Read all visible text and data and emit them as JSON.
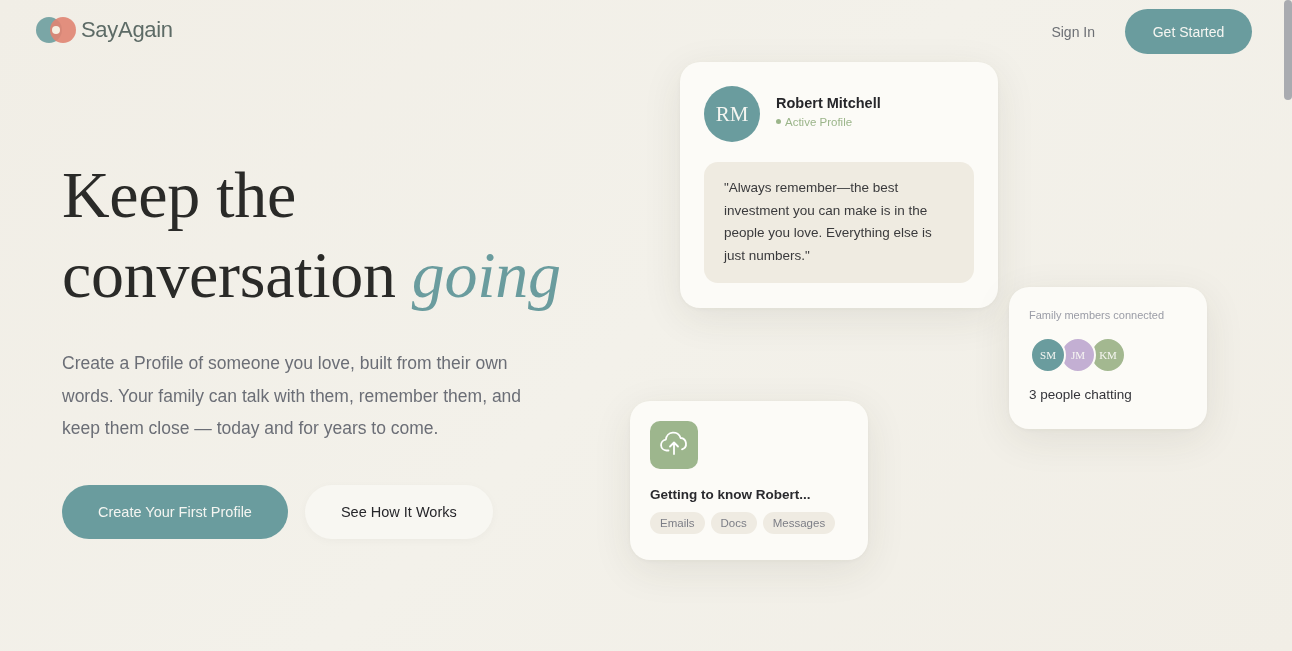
{
  "nav": {
    "logo": "SayAgain",
    "sign_in": "Sign In",
    "cta": "Get Started"
  },
  "hero": {
    "title": "Keep the conversation *going*",
    "description": "Create a Profile of someone you love, built from their own words. Your family can talk with them, remember them, and keep them close — today and for years to come.",
    "buttons": [
      {
        "label": "Create Your First Profile",
        "kind": "primary"
      },
      {
        "label": "See How It Works",
        "kind": "secondary"
      }
    ]
  },
  "profile_card": {
    "initials": "RM",
    "name": "Robert Mitchell",
    "status": "Active Profile",
    "quote": "\"Always remember—the best investment you can make is in the people you love. Everything else is just numbers.\""
  },
  "family_card": {
    "title": "Family members connected",
    "members": [
      {
        "initials": "SM",
        "color": "#6a9c9e"
      },
      {
        "initials": "JM",
        "color": "#c3afd3"
      },
      {
        "initials": "KM",
        "color": "#a3b890"
      }
    ],
    "summary": "3 people chatting"
  },
  "upload_card": {
    "title": "Getting to know Robert...",
    "tags": [
      "Emails",
      "Docs",
      "Messages"
    ]
  }
}
